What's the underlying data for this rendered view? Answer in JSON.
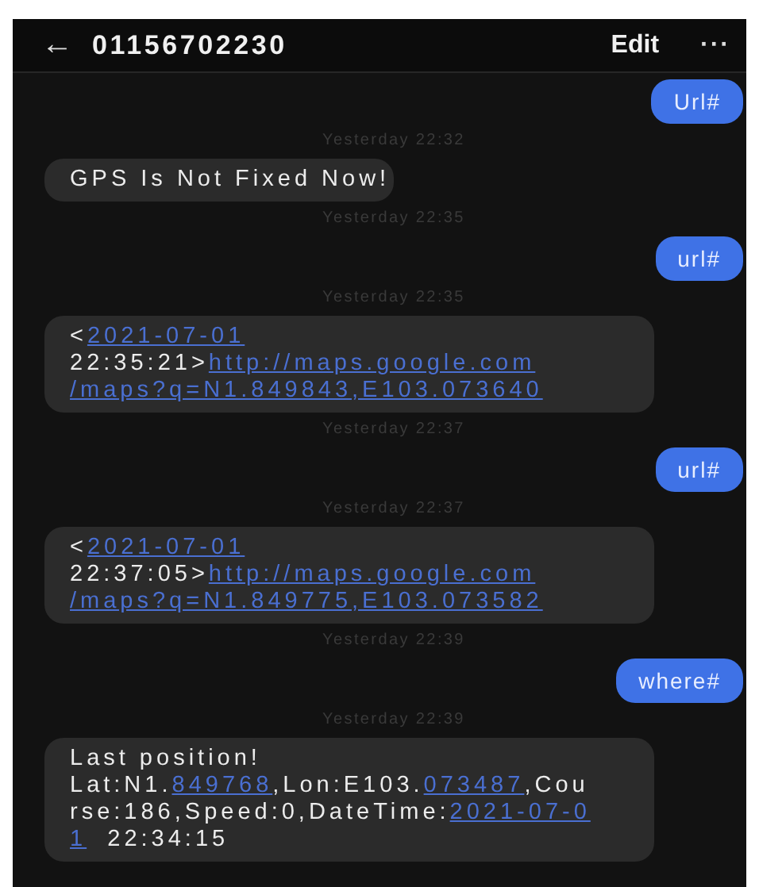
{
  "header": {
    "back": "←",
    "title": "01156702230",
    "edit": "Edit",
    "more": "···"
  },
  "messages": [
    {
      "kind": "sent",
      "text": "Url#"
    },
    {
      "kind": "time",
      "text": "Yesterday 22:32"
    },
    {
      "kind": "received",
      "lines": [
        [
          {
            "text": "GPS Is Not Fixed Now!",
            "link": false
          }
        ]
      ]
    },
    {
      "kind": "time",
      "text": "Yesterday 22:35"
    },
    {
      "kind": "sent",
      "text": "url#"
    },
    {
      "kind": "time",
      "text": "Yesterday 22:35"
    },
    {
      "kind": "received",
      "lines": [
        [
          {
            "text": "<",
            "link": false
          },
          {
            "text": "2021-07-01",
            "link": true
          }
        ],
        [
          {
            "text": "22:35:21>",
            "link": false
          },
          {
            "text": "http://maps.google.com",
            "link": true
          }
        ],
        [
          {
            "text": "/maps?q=N1.849843,E103.073640",
            "link": true
          }
        ]
      ]
    },
    {
      "kind": "time",
      "text": "Yesterday 22:37"
    },
    {
      "kind": "sent",
      "text": "url#"
    },
    {
      "kind": "time",
      "text": "Yesterday 22:37"
    },
    {
      "kind": "received",
      "lines": [
        [
          {
            "text": "<",
            "link": false
          },
          {
            "text": "2021-07-01",
            "link": true
          }
        ],
        [
          {
            "text": "22:37:05>",
            "link": false
          },
          {
            "text": "http://maps.google.com",
            "link": true
          }
        ],
        [
          {
            "text": "/maps?q=N1.849775,E103.073582",
            "link": true
          }
        ]
      ]
    },
    {
      "kind": "time",
      "text": "Yesterday 22:39"
    },
    {
      "kind": "sent",
      "text": "where#"
    },
    {
      "kind": "time",
      "text": "Yesterday 22:39"
    },
    {
      "kind": "received",
      "lines": [
        [
          {
            "text": "Last position!",
            "link": false
          }
        ],
        [
          {
            "text": "Lat:N1.",
            "link": false
          },
          {
            "text": "849768",
            "link": true
          },
          {
            "text": ",Lon:E103.",
            "link": false
          },
          {
            "text": "073487",
            "link": true
          },
          {
            "text": ",Cou",
            "link": false
          }
        ],
        [
          {
            "text": "rse:186,Speed:0,DateTime:",
            "link": false
          },
          {
            "text": "2021-07-0",
            "link": true
          }
        ],
        [
          {
            "text": "1",
            "link": true
          },
          {
            "text": "  22:34:15",
            "link": false
          }
        ]
      ]
    }
  ]
}
